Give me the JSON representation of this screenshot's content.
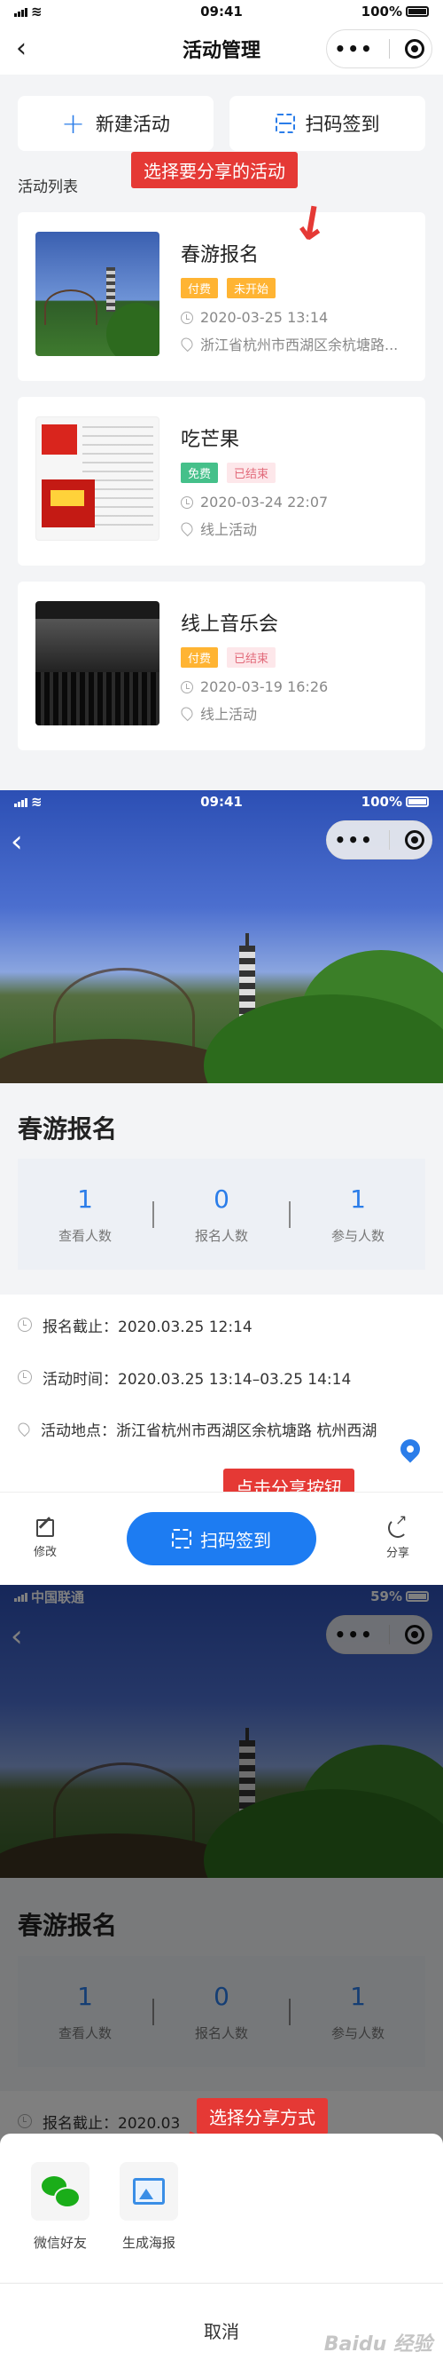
{
  "panel1": {
    "status": {
      "time": "09:41",
      "battery": "100%"
    },
    "nav": {
      "title": "活动管理"
    },
    "actions": {
      "new_label": "新建活动",
      "scan_label": "扫码签到"
    },
    "list_label": "活动列表",
    "callout": "选择要分享的活动",
    "cards": [
      {
        "title": "春游报名",
        "tags": [
          "付费",
          "未开始"
        ],
        "time": "2020-03-25 13:14",
        "location": "浙江省杭州市西湖区余杭塘路..."
      },
      {
        "title": "吃芒果",
        "tags": [
          "免费",
          "已结束"
        ],
        "time": "2020-03-24 22:07",
        "location": "线上活动"
      },
      {
        "title": "线上音乐会",
        "tags": [
          "付费",
          "已结束"
        ],
        "time": "2020-03-19 16:26",
        "location": "线上活动"
      }
    ]
  },
  "panel2": {
    "status": {
      "time": "09:41",
      "battery": "100%"
    },
    "title": "春游报名",
    "stats": [
      {
        "value": "1",
        "label": "查看人数"
      },
      {
        "value": "0",
        "label": "报名人数"
      },
      {
        "value": "1",
        "label": "参与人数"
      }
    ],
    "deadline": "报名截止：2020.03.25 12:14",
    "activity_time": "活动时间：2020.03.25 13:14–03.25 14:14",
    "location": "活动地点：浙江省杭州市西湖区余杭塘路 杭州西湖",
    "callout": "点击分享按钮",
    "bottom": {
      "edit_label": "修改",
      "scan_label": "扫码签到",
      "share_label": "分享"
    }
  },
  "panel3": {
    "status": {
      "carrier": "中国联通",
      "battery": "59%"
    },
    "title": "春游报名",
    "stats": [
      {
        "value": "1",
        "label": "查看人数"
      },
      {
        "value": "0",
        "label": "报名人数"
      },
      {
        "value": "1",
        "label": "参与人数"
      }
    ],
    "deadline": "报名截止：2020.03",
    "callout": "选择分享方式",
    "share": {
      "wechat_label": "微信好友",
      "poster_label": "生成海报",
      "cancel_label": "取消"
    },
    "watermark": "Baidu 经验"
  }
}
